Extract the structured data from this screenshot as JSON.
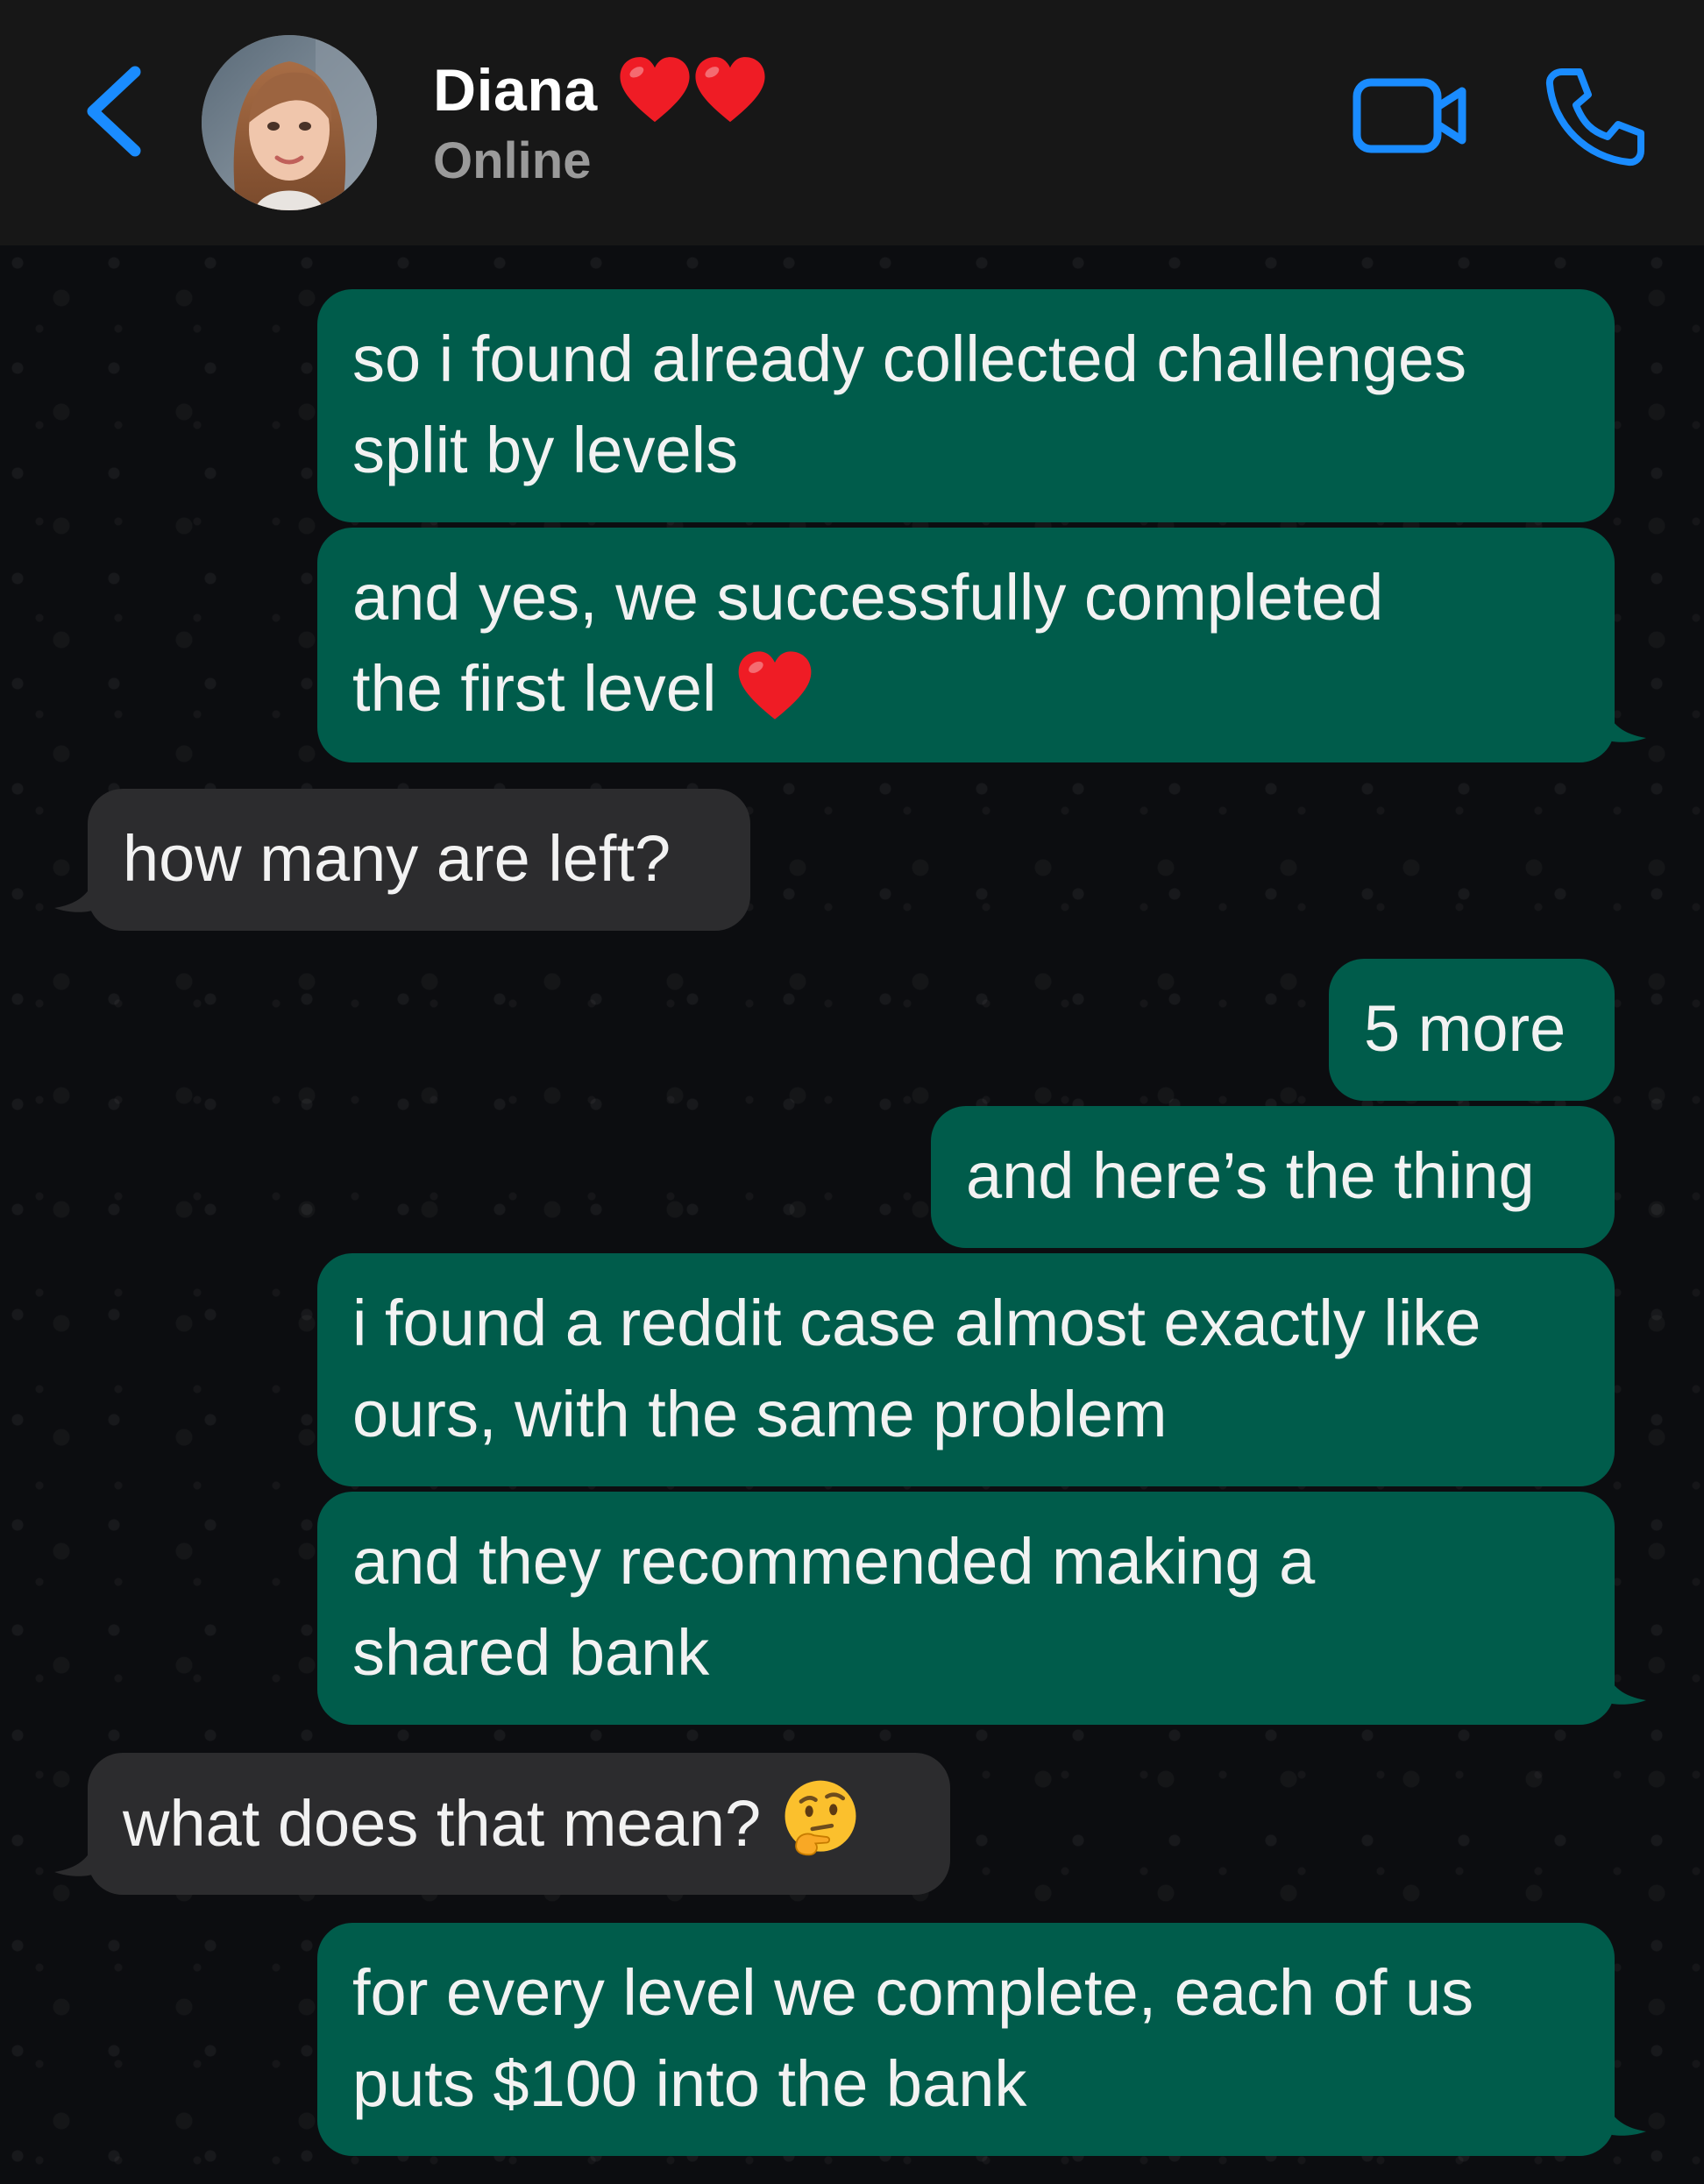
{
  "header": {
    "contact_name": "Diana",
    "status": "Online",
    "name_emoji": "❤️❤️"
  },
  "icons": {
    "back": "chevron-left-icon",
    "video": "video-camera-icon",
    "call": "phone-icon"
  },
  "colors": {
    "accent": "#1a8cff",
    "outgoing_bubble": "#005c4b",
    "incoming_bubble": "#2c2c2e",
    "header_bg": "#171717",
    "chat_bg": "#0c0d10"
  },
  "messages": [
    {
      "direction": "outgoing",
      "lines": [
        "so i found already collected challenges",
        "split by levels"
      ]
    },
    {
      "direction": "outgoing",
      "lines": [
        "and yes, we successfully completed",
        "the first level"
      ],
      "emoji": "❤️"
    },
    {
      "direction": "incoming",
      "lines": [
        "how many are left?"
      ]
    },
    {
      "direction": "outgoing",
      "lines": [
        "5 more"
      ]
    },
    {
      "direction": "outgoing",
      "lines": [
        "and here’s the thing"
      ]
    },
    {
      "direction": "outgoing",
      "lines": [
        "i found a reddit case almost exactly like",
        "ours, with the same problem"
      ]
    },
    {
      "direction": "outgoing",
      "lines": [
        "and they recommended making a",
        "shared bank"
      ]
    },
    {
      "direction": "incoming",
      "lines": [
        "what does that mean?"
      ],
      "emoji": "🤔"
    },
    {
      "direction": "outgoing",
      "lines": [
        "for every level we complete, each of us",
        "puts $100 into the bank"
      ]
    }
  ]
}
